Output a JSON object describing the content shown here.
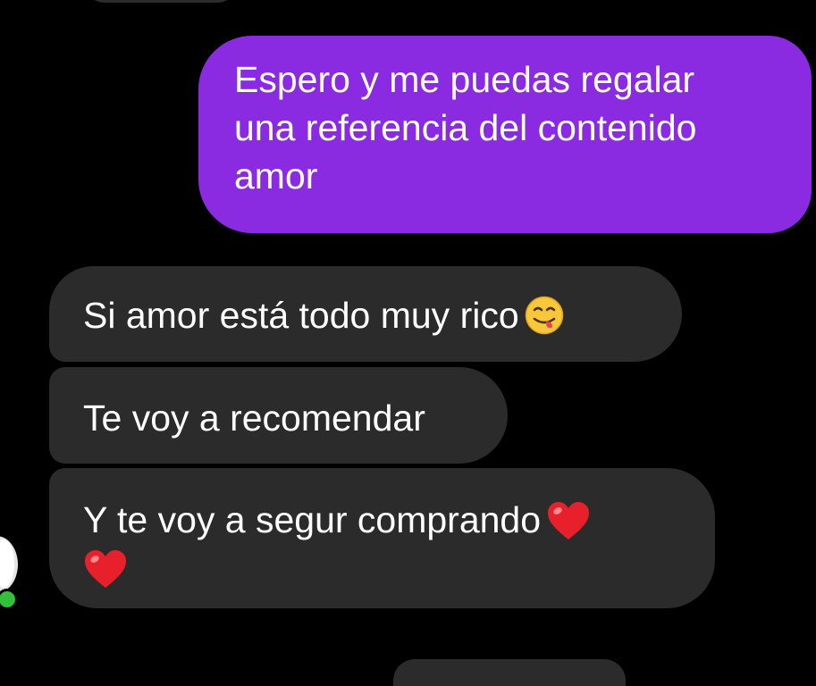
{
  "colors": {
    "background": "#000000",
    "sent_bubble": "#8a2be2",
    "received_bubble": "#2b2b2b",
    "text": "#ffffff",
    "online_indicator": "#31c13a"
  },
  "messages": {
    "sent": [
      {
        "lines": [
          "Espero y me puedas regalar",
          "una referencia del contenido",
          "amor"
        ]
      }
    ],
    "received": [
      {
        "text": "Si amor está todo muy rico",
        "emojis": [
          "face-savoring-food-emoji"
        ]
      },
      {
        "text": "Te voy a recomendar",
        "emojis": []
      },
      {
        "text": "Y te voy a segur comprando",
        "emojis": [
          "red-heart-emoji",
          "red-heart-emoji"
        ]
      }
    ]
  },
  "contact": {
    "avatar_icon": "avatar-icon",
    "online_status_icon": "online-dot-icon"
  }
}
